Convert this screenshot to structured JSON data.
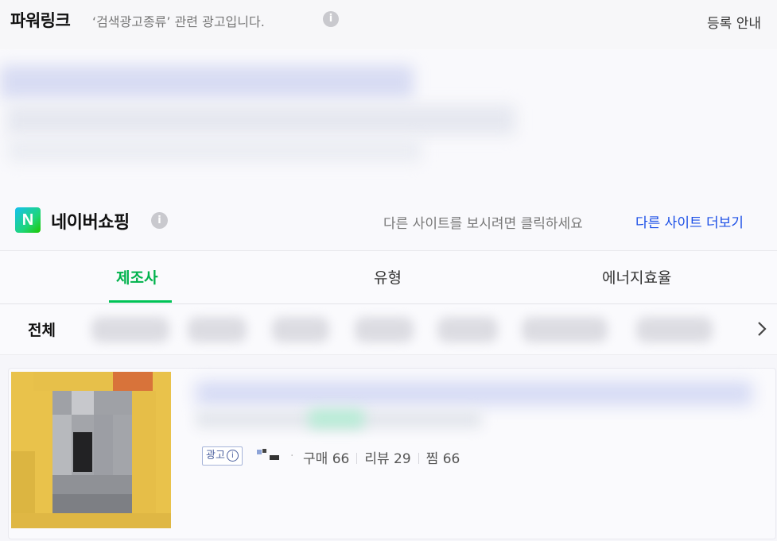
{
  "powerlink": {
    "title": "파워링크",
    "description": "‘검색광고종류’ 관련 광고입니다.",
    "info_icon": "i",
    "register_label": "등록 안내"
  },
  "naver_shopping": {
    "logo_letter": "N",
    "title": "네이버쇼핑",
    "info_icon": "i",
    "hint": "다른 사이트를 보시려면 클릭하세요",
    "more_label": "다른 사이트 더보기"
  },
  "tabs": [
    {
      "label": "제조사",
      "active": true
    },
    {
      "label": "유형",
      "active": false
    },
    {
      "label": "에너지효율",
      "active": false
    }
  ],
  "filters": {
    "all_label": "전체",
    "next_icon": "chevron-right-icon"
  },
  "product": {
    "ad_badge": "광고",
    "ad_badge_icon": "i",
    "stats": {
      "purchase_label": "구매",
      "purchase_count": "66",
      "review_label": "리뷰",
      "review_count": "29",
      "wish_label": "찜",
      "wish_count": "66"
    }
  },
  "colors": {
    "accent_green": "#00c356",
    "link_blue": "#1a4ee6"
  }
}
